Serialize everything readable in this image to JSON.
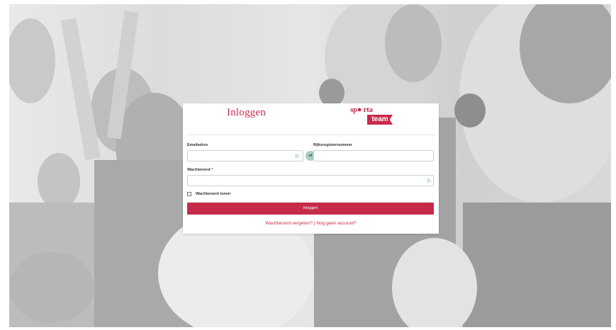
{
  "login": {
    "title": "Inloggen",
    "logo": {
      "part1": "sp● rta",
      "part2": "team",
      "brand_color": "#c72b4a"
    },
    "email_label": "Emailadres",
    "national_id_label": "Rijksregisternummer",
    "or_badge": "of",
    "password_label": "Wachtwoord",
    "required_marker": "*",
    "show_password_label": "Wachtwoord tonen",
    "submit_label": "Inloggen",
    "forgot_password_link": "Wachtwoord vergeten?",
    "link_separator": "|",
    "no_account_link": "Nog geen account?"
  },
  "colors": {
    "accent": "#c72b4a",
    "field_icon": "#2f7fb8",
    "badge_bg": "#a8d0c0"
  },
  "icons": {
    "field_icon": "key-icon"
  }
}
